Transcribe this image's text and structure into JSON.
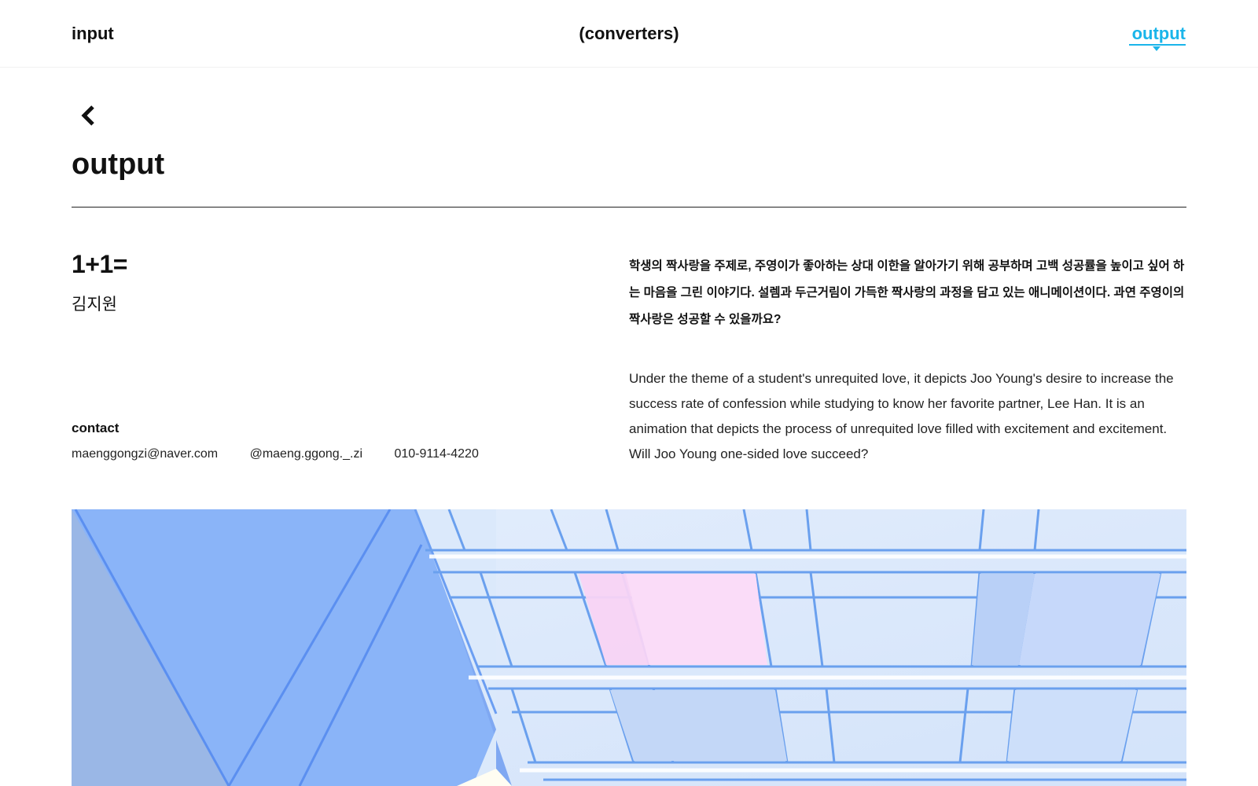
{
  "nav": {
    "input_label": "input",
    "converters_label": "(converters)",
    "output_label": "output"
  },
  "colors": {
    "accent": "#1ab5ea",
    "text": "#111111",
    "panel_blue": "#8ab4f8",
    "window_blue": "#dbe9fb",
    "pink": "#f8d4f4"
  },
  "icons": {
    "back": "chevron-left-icon"
  },
  "page": {
    "title": "output"
  },
  "work": {
    "title": "1+1=",
    "author": "김지원",
    "description_ko": "학생의 짝사랑을 주제로, 주영이가 좋아하는 상대 이한을 알아가기 위해 공부하며 고백 성공률을 높이고 싶어 하는 마음을 그린 이야기다. 설렘과 두근거림이 가득한 짝사랑의 과정을 담고 있는 애니메이션이다. 과연 주영이의 짝사랑은 성공할 수 있을까요?",
    "description_en": "Under the theme of a student's unrequited love, it depicts Joo Young's desire to increase the success rate of confession while studying to know her favorite partner, Lee Han. It is an animation that depicts the process of unrequited love filled with excitement and excitement. Will Joo Young one-sided love succeed?"
  },
  "contact": {
    "label": "contact",
    "email": "maenggongzi@naver.com",
    "instagram": "@maeng.ggong._.zi",
    "phone": "010-9114-4220"
  }
}
